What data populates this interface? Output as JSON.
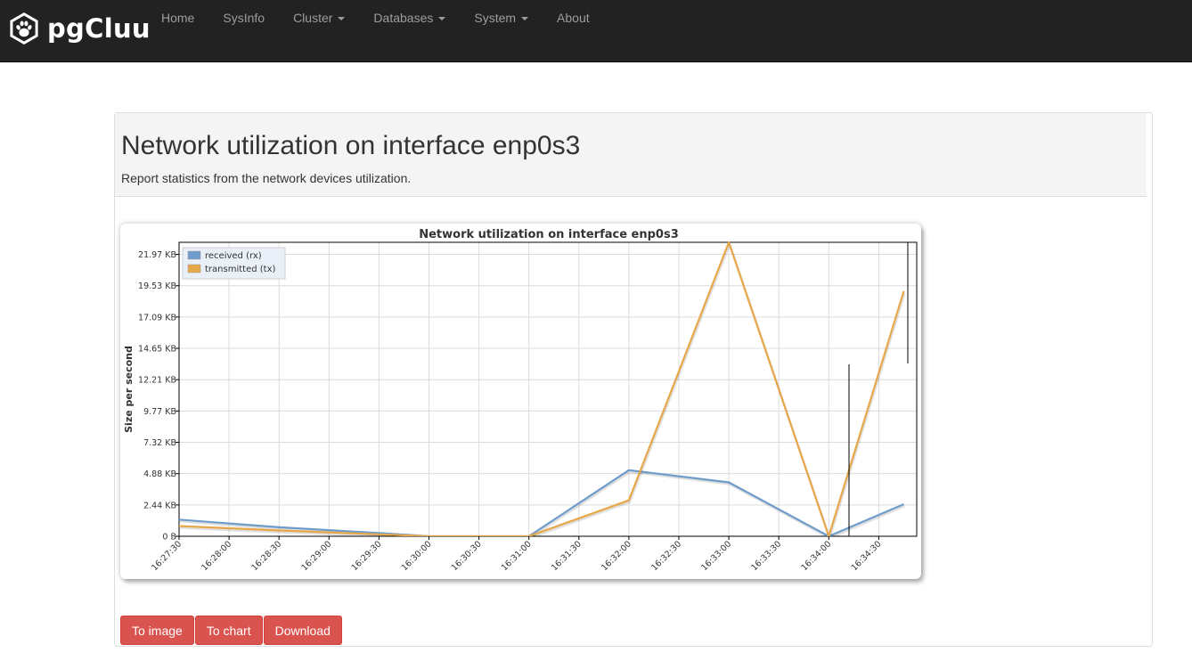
{
  "app": {
    "brand": "pgCluu"
  },
  "nav": {
    "items": [
      {
        "label": "Home",
        "dropdown": false
      },
      {
        "label": "SysInfo",
        "dropdown": false
      },
      {
        "label": "Cluster",
        "dropdown": true
      },
      {
        "label": "Databases",
        "dropdown": true
      },
      {
        "label": "System",
        "dropdown": true
      },
      {
        "label": "About",
        "dropdown": false
      }
    ]
  },
  "page": {
    "title": "Network utilization on interface enp0s3",
    "description": "Report statistics from the network devices utilization."
  },
  "buttons": {
    "to_image": "To image",
    "to_chart": "To chart",
    "download": "Download"
  },
  "colors": {
    "navbar": "#222222",
    "button": "#d9534f",
    "rx": "#6f9ccb",
    "tx": "#e7a84a"
  },
  "chart_data": {
    "type": "line",
    "title": "Network utilization on interface enp0s3",
    "xlabel": "",
    "ylabel": "Size per second",
    "x": [
      "16:27:30",
      "16:28:30",
      "16:29:30",
      "16:30:00",
      "16:30:30",
      "16:31:00",
      "16:32:00",
      "16:33:00",
      "16:34:00",
      "16:34:45"
    ],
    "series": [
      {
        "name": "received (rx)",
        "values": [
          1.3,
          0.7,
          0.25,
          0.0,
          0.0,
          0.0,
          5.15,
          4.2,
          0.0,
          2.5
        ]
      },
      {
        "name": "transmitted (tx)",
        "values": [
          0.8,
          0.45,
          0.15,
          0.0,
          0.0,
          0.0,
          2.8,
          22.9,
          0.0,
          19.1
        ]
      }
    ],
    "x_tick_labels": [
      "16:27:30",
      "16:28:00",
      "16:28:30",
      "16:29:00",
      "16:29:30",
      "16:30:00",
      "16:30:30",
      "16:31:00",
      "16:31:30",
      "16:32:00",
      "16:32:30",
      "16:33:00",
      "16:33:30",
      "16:34:00",
      "16:34:30"
    ],
    "y_tick_labels": [
      "0 B",
      "2.44 KB",
      "4.88 KB",
      "7.32 KB",
      "9.77 KB",
      "12.21 KB",
      "14.65 KB",
      "17.09 KB",
      "19.53 KB",
      "21.97 KB"
    ],
    "ylim": [
      0,
      22.9
    ],
    "grid": true,
    "legend_position": "top-left"
  }
}
